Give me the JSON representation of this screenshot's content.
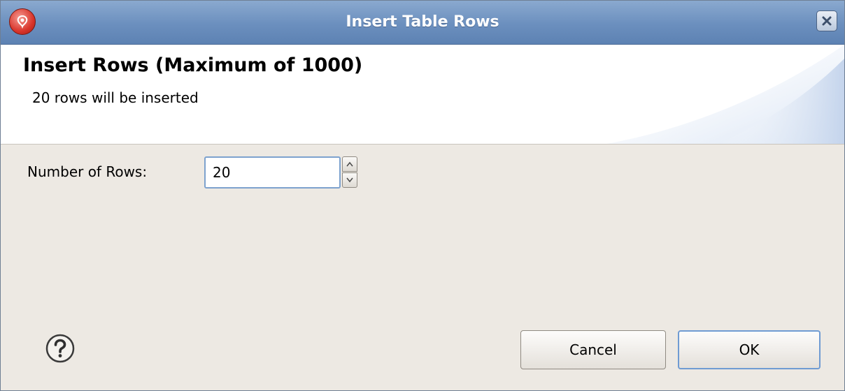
{
  "window": {
    "title": "Insert Table Rows",
    "app_icon": "eclipse-app-icon",
    "close_icon": "close-icon"
  },
  "banner": {
    "title": "Insert Rows (Maximum of 1000)",
    "message": "20 rows will be inserted"
  },
  "form": {
    "rows_label": "Number of Rows:",
    "rows_value": "20"
  },
  "footer": {
    "help_icon": "help-icon",
    "cancel_label": "Cancel",
    "ok_label": "OK"
  },
  "colors": {
    "titlebar": "#6b8fbe",
    "dialog_bg": "#ede9e3",
    "banner_bg": "#ffffff",
    "focus_border": "#7da2ce"
  }
}
